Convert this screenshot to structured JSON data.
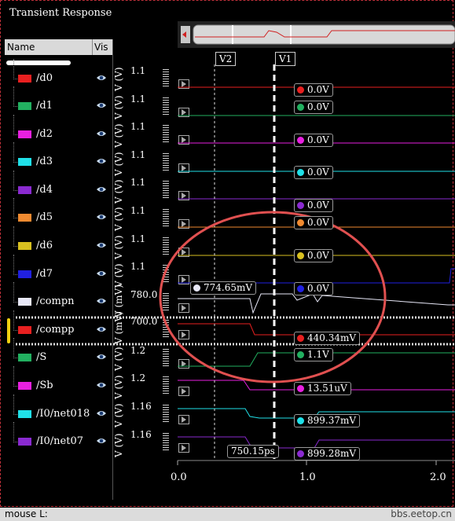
{
  "window": {
    "title": "Transient Response"
  },
  "signal_panel": {
    "col_name": "Name",
    "col_vis": "Vis",
    "signals": [
      {
        "name": "/d0",
        "color": "#e82020"
      },
      {
        "name": "/d1",
        "color": "#22b060"
      },
      {
        "name": "/d2",
        "color": "#e820e0"
      },
      {
        "name": "/d3",
        "color": "#20e0e8"
      },
      {
        "name": "/d4",
        "color": "#8a2ad0"
      },
      {
        "name": "/d5",
        "color": "#f08a30"
      },
      {
        "name": "/d6",
        "color": "#d8c020"
      },
      {
        "name": "/d7",
        "color": "#2020e0"
      },
      {
        "name": "/compn",
        "color": "#e8e8f8"
      },
      {
        "name": "/compp",
        "color": "#e82020"
      },
      {
        "name": "/S",
        "color": "#22b060"
      },
      {
        "name": "/Sb",
        "color": "#e820e0"
      },
      {
        "name": "/I0/net018",
        "color": "#20e0e8"
      },
      {
        "name": "/I0/net07",
        "color": "#8a2ad0"
      }
    ]
  },
  "y_axis": {
    "unit_labels": [
      "V (V)",
      "V (V)",
      "V (V)",
      "V (V)",
      "V (V)",
      "V (V)",
      "V (V)",
      "V (V)",
      "V (mV)",
      "V (mV)",
      "V (V)",
      "V (V)",
      "V (V)",
      "V (V)"
    ],
    "ticks": [
      "1.1",
      "1.1",
      "1.1",
      "1.1",
      "1.1",
      "1.1",
      "1.1",
      "1.1",
      "780.0",
      "700.0",
      "1.2",
      "1.2",
      "1.16",
      "1.16"
    ]
  },
  "cursors": {
    "v1": "V1",
    "v2": "V2",
    "delta_label": "750.15ps"
  },
  "markers": [
    {
      "label": "0.0V",
      "color": "#e82020"
    },
    {
      "label": "0.0V",
      "color": "#22b060"
    },
    {
      "label": "0.0V",
      "color": "#e820e0"
    },
    {
      "label": "0.0V",
      "color": "#20e0e8"
    },
    {
      "label": "0.0V",
      "color": "#8a2ad0"
    },
    {
      "label": "0.0V",
      "color": "#f08a30"
    },
    {
      "label": "0.0V",
      "color": "#d8c020"
    },
    {
      "label": "0.0V",
      "color": "#2020e0"
    },
    {
      "label": "440.34mV",
      "color": "#e82020"
    },
    {
      "label": "1.1V",
      "color": "#22b060"
    },
    {
      "label": "13.51uV",
      "color": "#e820e0"
    },
    {
      "label": "899.37mV",
      "color": "#20e0e8"
    },
    {
      "label": "899.28mV",
      "color": "#8a2ad0"
    }
  ],
  "v2_marker": {
    "label": "774.65mV",
    "color": "#e8e8f8"
  },
  "x_axis": {
    "ticks": [
      "0.0",
      "1.0",
      "2.0"
    ]
  },
  "status_bar": {
    "mouse_label": "mouse L:",
    "watermark": "bbs.eetop.cn"
  },
  "annotation": {
    "color": "#e05050"
  }
}
